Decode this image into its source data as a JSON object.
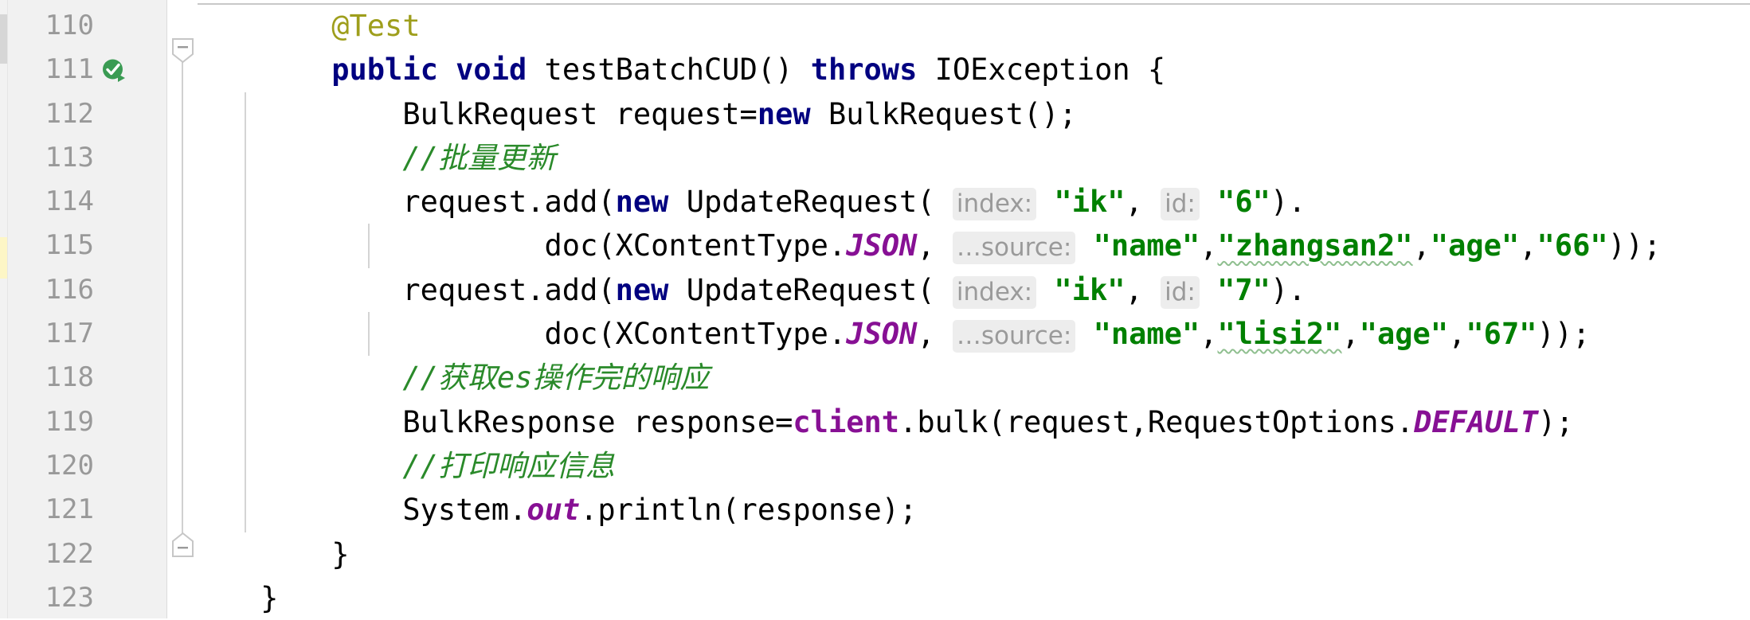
{
  "editor": {
    "app": "code-editor",
    "language": "java",
    "colors": {
      "background": "#ffffff",
      "gutter_background": "#f1f1f1",
      "line_number": "#999999",
      "keyword": "#000080",
      "string": "#008000",
      "comment": "#2a8a2a",
      "annotation": "#9e9e1c",
      "static_field": "#871094",
      "param_hint_text": "#9a9a9a",
      "param_hint_background": "#ededed",
      "run_icon": "#3a9b53"
    },
    "gutter": {
      "line_numbers": [
        "110",
        "111",
        "112",
        "113",
        "114",
        "115",
        "116",
        "117",
        "118",
        "119",
        "120",
        "121",
        "122",
        "123"
      ],
      "run_test_icon": {
        "name": "run-test-icon",
        "line": "111",
        "tooltip": "Run Test"
      },
      "fold_markers": [
        {
          "name": "fold-collapse-start",
          "line": "111",
          "state": "expanded"
        },
        {
          "name": "fold-collapse-end",
          "line": "122",
          "state": "expanded"
        }
      ]
    },
    "lines": [
      {
        "number": "110",
        "indent_guides": 0,
        "tokens": [
          {
            "t": "        ",
            "k": "plain"
          },
          {
            "t": "@Test",
            "k": "annotation"
          }
        ]
      },
      {
        "number": "111",
        "indent_guides": 0,
        "tokens": [
          {
            "t": "        ",
            "k": "plain"
          },
          {
            "t": "public",
            "k": "keyword"
          },
          {
            "t": " ",
            "k": "plain"
          },
          {
            "t": "void",
            "k": "keyword"
          },
          {
            "t": " testBatchCUD() ",
            "k": "plain"
          },
          {
            "t": "throws",
            "k": "keyword"
          },
          {
            "t": " IOException {",
            "k": "plain"
          }
        ]
      },
      {
        "number": "112",
        "indent_guides": 1,
        "tokens": [
          {
            "t": "            ",
            "k": "plain"
          },
          {
            "t": "BulkRequest request=",
            "k": "plain"
          },
          {
            "t": "new",
            "k": "keyword"
          },
          {
            "t": " BulkRequest();",
            "k": "plain"
          }
        ]
      },
      {
        "number": "113",
        "indent_guides": 1,
        "tokens": [
          {
            "t": "            ",
            "k": "plain"
          },
          {
            "t": "//批量更新",
            "k": "comment"
          }
        ]
      },
      {
        "number": "114",
        "indent_guides": 1,
        "tokens": [
          {
            "t": "            ",
            "k": "plain"
          },
          {
            "t": "request.add(",
            "k": "plain"
          },
          {
            "t": "new",
            "k": "keyword"
          },
          {
            "t": " UpdateRequest(",
            "k": "plain"
          },
          {
            "t": " ",
            "k": "plain"
          },
          {
            "t": "index:",
            "k": "hint"
          },
          {
            "t": " ",
            "k": "plain"
          },
          {
            "t": "\"ik\"",
            "k": "string"
          },
          {
            "t": ", ",
            "k": "plain"
          },
          {
            "t": "id:",
            "k": "hint"
          },
          {
            "t": " ",
            "k": "plain"
          },
          {
            "t": "\"6\"",
            "k": "string"
          },
          {
            "t": ").",
            "k": "plain"
          }
        ]
      },
      {
        "number": "115",
        "indent_guides": 2,
        "tokens": [
          {
            "t": "                    ",
            "k": "plain"
          },
          {
            "t": "doc(XContentType.",
            "k": "plain"
          },
          {
            "t": "JSON",
            "k": "static"
          },
          {
            "t": ", ",
            "k": "plain"
          },
          {
            "t": "…source:",
            "k": "hint"
          },
          {
            "t": " ",
            "k": "plain"
          },
          {
            "t": "\"name\"",
            "k": "string"
          },
          {
            "t": ",",
            "k": "plain"
          },
          {
            "t": "\"zhangsan2\"",
            "k": "string-spell"
          },
          {
            "t": ",",
            "k": "plain"
          },
          {
            "t": "\"age\"",
            "k": "string"
          },
          {
            "t": ",",
            "k": "plain"
          },
          {
            "t": "\"66\"",
            "k": "string"
          },
          {
            "t": "));",
            "k": "plain"
          }
        ]
      },
      {
        "number": "116",
        "indent_guides": 1,
        "tokens": [
          {
            "t": "            ",
            "k": "plain"
          },
          {
            "t": "request.add(",
            "k": "plain"
          },
          {
            "t": "new",
            "k": "keyword"
          },
          {
            "t": " UpdateRequest(",
            "k": "plain"
          },
          {
            "t": " ",
            "k": "plain"
          },
          {
            "t": "index:",
            "k": "hint"
          },
          {
            "t": " ",
            "k": "plain"
          },
          {
            "t": "\"ik\"",
            "k": "string"
          },
          {
            "t": ", ",
            "k": "plain"
          },
          {
            "t": "id:",
            "k": "hint"
          },
          {
            "t": " ",
            "k": "plain"
          },
          {
            "t": "\"7\"",
            "k": "string"
          },
          {
            "t": ").",
            "k": "plain"
          }
        ]
      },
      {
        "number": "117",
        "indent_guides": 2,
        "tokens": [
          {
            "t": "                    ",
            "k": "plain"
          },
          {
            "t": "doc(XContentType.",
            "k": "plain"
          },
          {
            "t": "JSON",
            "k": "static"
          },
          {
            "t": ", ",
            "k": "plain"
          },
          {
            "t": "…source:",
            "k": "hint"
          },
          {
            "t": " ",
            "k": "plain"
          },
          {
            "t": "\"name\"",
            "k": "string"
          },
          {
            "t": ",",
            "k": "plain"
          },
          {
            "t": "\"lisi2\"",
            "k": "string-spell"
          },
          {
            "t": ",",
            "k": "plain"
          },
          {
            "t": "\"age\"",
            "k": "string"
          },
          {
            "t": ",",
            "k": "plain"
          },
          {
            "t": "\"67\"",
            "k": "string"
          },
          {
            "t": "));",
            "k": "plain"
          }
        ]
      },
      {
        "number": "118",
        "indent_guides": 1,
        "tokens": [
          {
            "t": "            ",
            "k": "plain"
          },
          {
            "t": "//获取es操作完的响应",
            "k": "comment"
          }
        ]
      },
      {
        "number": "119",
        "indent_guides": 1,
        "tokens": [
          {
            "t": "            ",
            "k": "plain"
          },
          {
            "t": "BulkResponse response=",
            "k": "plain"
          },
          {
            "t": "client",
            "k": "field"
          },
          {
            "t": ".bulk(request,RequestOptions.",
            "k": "plain"
          },
          {
            "t": "DEFAULT",
            "k": "static"
          },
          {
            "t": ");",
            "k": "plain"
          }
        ]
      },
      {
        "number": "120",
        "indent_guides": 1,
        "tokens": [
          {
            "t": "            ",
            "k": "plain"
          },
          {
            "t": "//打印响应信息",
            "k": "comment"
          }
        ]
      },
      {
        "number": "121",
        "indent_guides": 1,
        "tokens": [
          {
            "t": "            ",
            "k": "plain"
          },
          {
            "t": "System.",
            "k": "plain"
          },
          {
            "t": "out",
            "k": "static"
          },
          {
            "t": ".println(response);",
            "k": "plain"
          }
        ]
      },
      {
        "number": "122",
        "indent_guides": 0,
        "tokens": [
          {
            "t": "        ",
            "k": "plain"
          },
          {
            "t": "}",
            "k": "plain"
          }
        ]
      },
      {
        "number": "123",
        "indent_guides": 0,
        "tokens": [
          {
            "t": "    ",
            "k": "plain"
          },
          {
            "t": "}",
            "k": "plain"
          }
        ]
      }
    ]
  }
}
